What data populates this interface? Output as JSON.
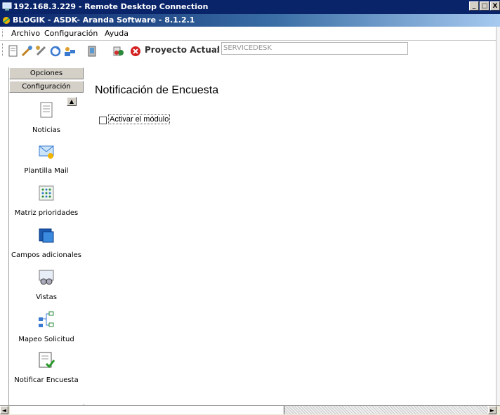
{
  "rdp": {
    "title": "192.168.3.229 - Remote Desktop Connection",
    "min": "_",
    "max": "□",
    "close": "X"
  },
  "app": {
    "title": "BLOGIK - ASDK- Aranda Software - 8.1.2.1"
  },
  "menu": {
    "items": [
      "Archivo",
      "Configuración",
      "Ayuda"
    ]
  },
  "toolbar": {
    "proyecto_label": "Proyecto Actual",
    "proyecto_sep": ":",
    "proyecto_value": "SERVICEDESK"
  },
  "sidebar": {
    "opciones": "Opciones",
    "configuracion": "Configuración",
    "items": [
      {
        "label": "Noticias",
        "icon": "document-icon"
      },
      {
        "label": "Plantilla Mail",
        "icon": "mail-icon"
      },
      {
        "label": "Matriz prioridades",
        "icon": "grid-dots-icon"
      },
      {
        "label": "Campos adicionales",
        "icon": "windows-icon"
      },
      {
        "label": "Vistas",
        "icon": "glasses-icon"
      },
      {
        "label": "Mapeo Solicitud",
        "icon": "tree-icon"
      },
      {
        "label": "Notificar Encuesta",
        "icon": "checklist-icon"
      }
    ]
  },
  "main": {
    "title": "Notificación de Encuesta",
    "checkbox_label": "Activar el módulo",
    "checkbox_checked": false
  },
  "colors": {
    "title_bar": "#0a246a",
    "chrome": "#d4d0c8"
  }
}
